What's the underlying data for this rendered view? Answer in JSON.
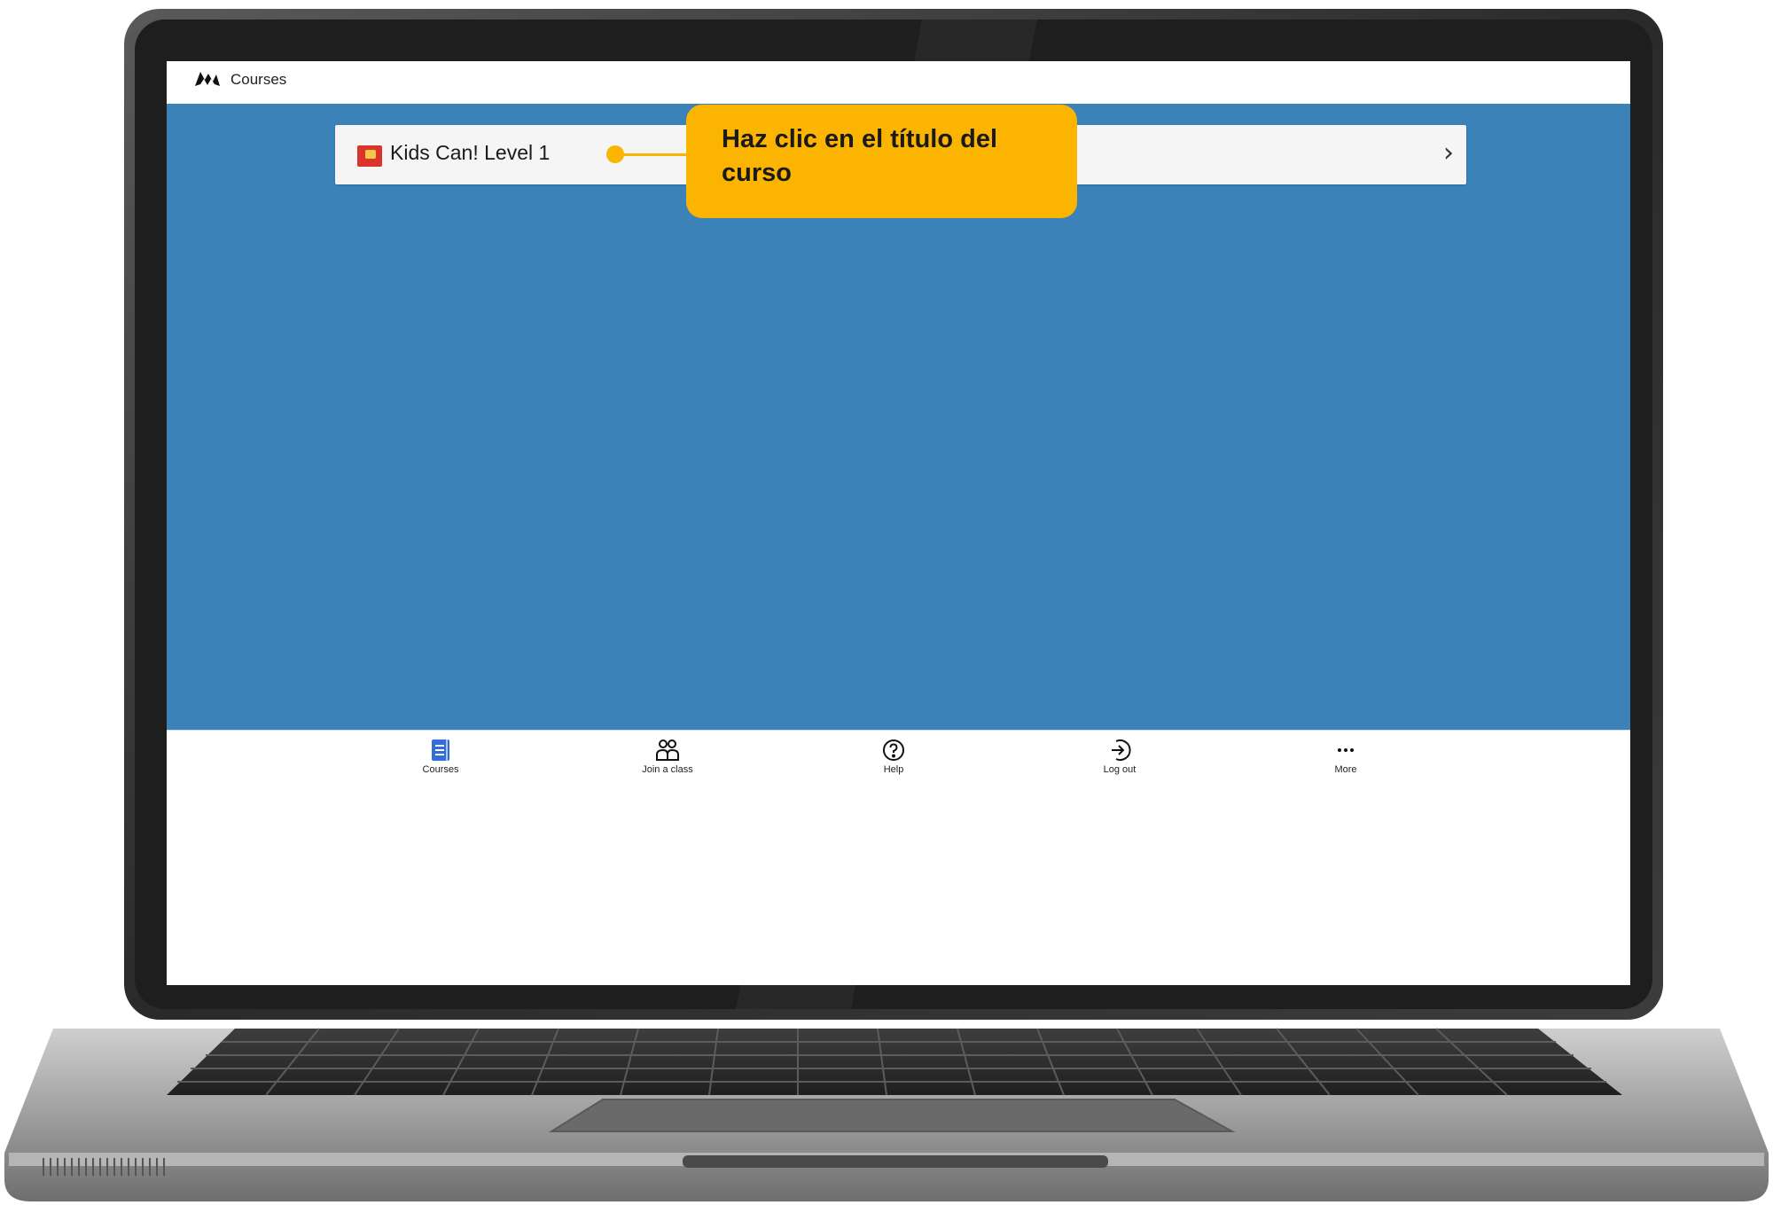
{
  "app": {
    "title": "Courses"
  },
  "courses": [
    {
      "title": "Kids Can! Level 1"
    }
  ],
  "callout": {
    "text": "Haz clic en el título del curso"
  },
  "bottom_nav": [
    {
      "label": "Courses",
      "icon": "book-icon",
      "active": true
    },
    {
      "label": "Join a class",
      "icon": "people-icon",
      "active": false
    },
    {
      "label": "Help",
      "icon": "question-circle-icon",
      "active": false
    },
    {
      "label": "Log out",
      "icon": "logout-icon",
      "active": false
    },
    {
      "label": "More",
      "icon": "more-dots-icon",
      "active": false
    }
  ],
  "colors": {
    "content_bg": "#3a82b8",
    "callout": "#fbb500",
    "active_nav": "#2f6fd6",
    "laptop_body": "#2b2b2b"
  }
}
